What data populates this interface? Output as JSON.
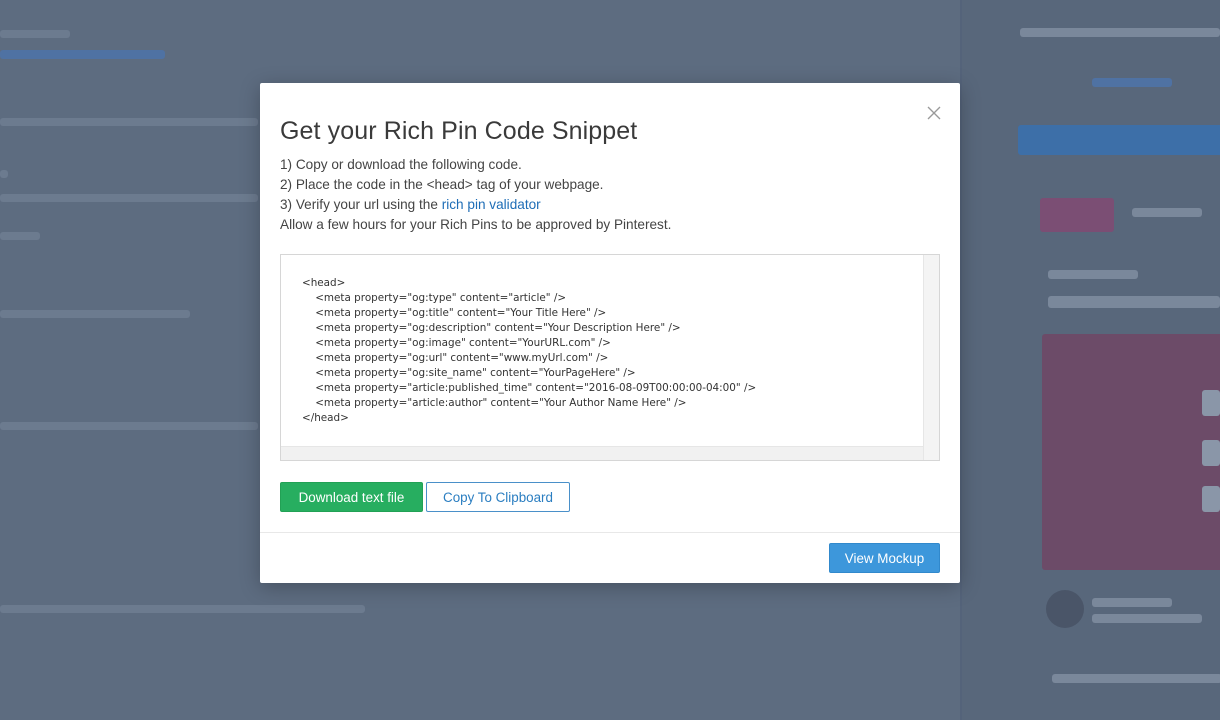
{
  "modal": {
    "title": "Get your Rich Pin Code Snippet",
    "steps": {
      "step1": "1) Copy or download the following code.",
      "step2": "2) Place the code in the <head> tag of your webpage.",
      "step3_prefix": "3) Verify your url using the ",
      "step3_link": "rich pin validator",
      "note": "Allow a few hours for your Rich Pins to be approved by Pinterest."
    },
    "code_lines": [
      "<head>",
      "    <meta property=\"og:type\" content=\"article\" />",
      "    <meta property=\"og:title\" content=\"Your Title Here\" />",
      "    <meta property=\"og:description\" content=\"Your Description Here\" />",
      "    <meta property=\"og:image\" content=\"YourURL.com\" />",
      "    <meta property=\"og:url\" content=\"www.myUrl.com\" />",
      "    <meta property=\"og:site_name\" content=\"YourPageHere\" />",
      "    <meta property=\"article:published_time\" content=\"2016-08-09T00:00:00-04:00\" />",
      "    <meta property=\"article:author\" content=\"Your Author Name Here\" />",
      "</head>"
    ],
    "buttons": {
      "download": "Download text file",
      "copy": "Copy To Clipboard",
      "view_mockup": "View Mockup"
    },
    "close_icon": "close-icon"
  },
  "colors": {
    "download_bg": "#27ae60",
    "copy_border": "#4a90c9",
    "view_bg": "#3d97db",
    "link": "#1e6db6",
    "overlay": "#5d6c80"
  }
}
